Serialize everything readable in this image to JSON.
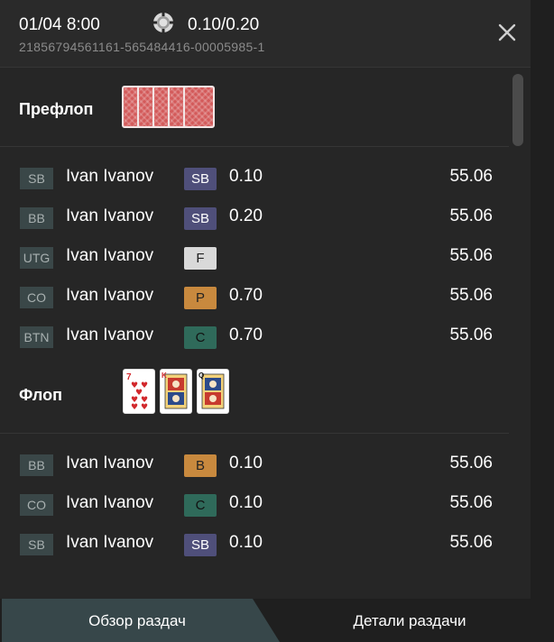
{
  "header": {
    "date": "01/04 8:00",
    "stakes": "0.10/0.20",
    "hand_id": "21856794561161-565484416-00005985-1",
    "close_icon": "close-icon",
    "chip_icon": "poker-chip-icon"
  },
  "colors": {
    "background": "#262626",
    "position_badge": "#3a4748",
    "action_sb": "#4f4f7a",
    "action_fold": "#d9d9d9",
    "action_post": "#c8893e",
    "action_call": "#2f6a5a",
    "tab_active": "#37474a"
  },
  "streets": [
    {
      "title": "Префлоп",
      "cards": [
        "back",
        "back",
        "back",
        "back",
        "back"
      ],
      "actions": [
        {
          "position": "SB",
          "name": "Ivan Ivanov",
          "action": "SB",
          "amount": "0.10",
          "stack": "55.06"
        },
        {
          "position": "BB",
          "name": "Ivan Ivanov",
          "action": "SB",
          "amount": "0.20",
          "stack": "55.06"
        },
        {
          "position": "UTG",
          "name": "Ivan Ivanov",
          "action": "F",
          "amount": "",
          "stack": "55.06"
        },
        {
          "position": "CO",
          "name": "Ivan Ivanov",
          "action": "P",
          "amount": "0.70",
          "stack": "55.06"
        },
        {
          "position": "BTN",
          "name": "Ivan Ivanov",
          "action": "C",
          "amount": "0.70",
          "stack": "55.06"
        }
      ]
    },
    {
      "title": "Флоп",
      "cards": [
        "7♥",
        "K♦",
        "Q♠"
      ],
      "actions": [
        {
          "position": "BB",
          "name": "Ivan Ivanov",
          "action": "B",
          "amount": "0.10",
          "stack": "55.06"
        },
        {
          "position": "CO",
          "name": "Ivan Ivanov",
          "action": "C",
          "amount": "0.10",
          "stack": "55.06"
        },
        {
          "position": "SB",
          "name": "Ivan Ivanov",
          "action": "SB",
          "amount": "0.10",
          "stack": "55.06"
        }
      ]
    }
  ],
  "tabs": [
    {
      "label": "Обзор раздач",
      "active": true
    },
    {
      "label": "Детали раздачи",
      "active": false
    }
  ]
}
